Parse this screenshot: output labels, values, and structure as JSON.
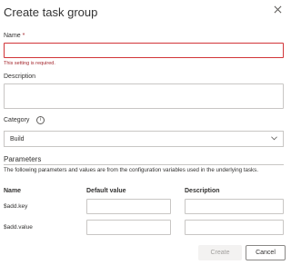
{
  "dialog": {
    "title": "Create task group",
    "close_icon": "close-icon"
  },
  "name": {
    "label": "Name",
    "required_mark": "*",
    "value": "",
    "error": "This setting is required."
  },
  "description": {
    "label": "Description",
    "value": ""
  },
  "category": {
    "label": "Category",
    "info_glyph": "i",
    "selected": "Build"
  },
  "parameters": {
    "title": "Parameters",
    "description": "The following parameters and values are from the configuration variables used in the underlying tasks.",
    "columns": {
      "name": "Name",
      "default_value": "Default value",
      "description": "Description"
    },
    "rows": [
      {
        "name": "$add.key",
        "default_value": "",
        "description": ""
      },
      {
        "name": "$add.value",
        "default_value": "",
        "description": ""
      }
    ]
  },
  "buttons": {
    "create": "Create",
    "cancel": "Cancel"
  },
  "colors": {
    "error": "#a4262c",
    "border": "#c8c6c4"
  }
}
